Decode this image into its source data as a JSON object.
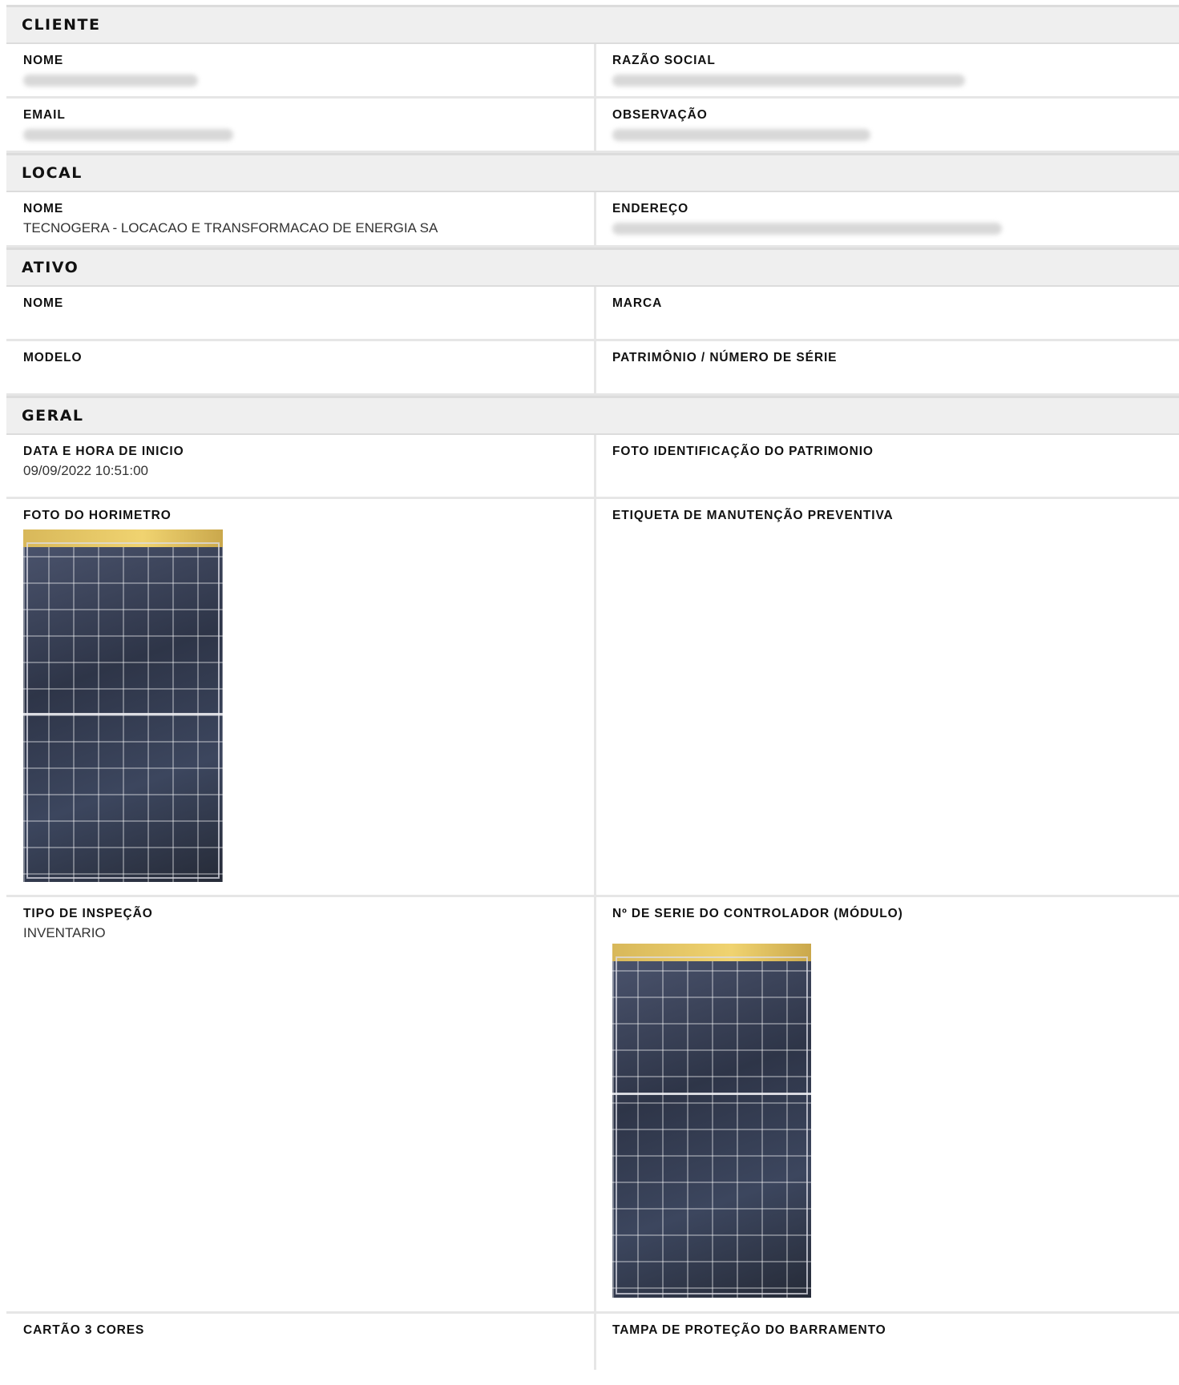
{
  "cliente": {
    "title": "CLIENTE",
    "nome_label": "NOME",
    "razao_social_label": "RAZÃO SOCIAL",
    "email_label": "EMAIL",
    "observacao_label": "OBSERVAÇÃO"
  },
  "local": {
    "title": "LOCAL",
    "nome_label": "NOME",
    "nome_value": "TECNOGERA - LOCACAO E TRANSFORMACAO DE ENERGIA SA",
    "endereco_label": "ENDEREÇO"
  },
  "ativo": {
    "title": "ATIVO",
    "nome_label": "NOME",
    "marca_label": "MARCA",
    "modelo_label": "MODELO",
    "patrimonio_label": "PATRIMÔNIO / NÚMERO DE SÉRIE"
  },
  "geral": {
    "title": "GERAL",
    "data_inicio_label": "DATA E HORA DE INICIO",
    "data_inicio_value": "09/09/2022 10:51:00",
    "foto_patrimonio_label": "FOTO IDENTIFICAÇÃO DO PATRIMONIO",
    "foto_horimetro_label": "FOTO DO HORIMETRO",
    "etiqueta_label": "ETIQUETA DE MANUTENÇÃO PREVENTIVA",
    "tipo_inspecao_label": "TIPO DE INSPEÇÃO",
    "tipo_inspecao_value": "INVENTARIO",
    "serie_controlador_label": "Nº DE SERIE DO CONTROLADOR (MÓDULO)",
    "cartao_label": "CARTÃO 3 CORES",
    "tampa_label": "TAMPA DE PROTEÇÃO DO BARRAMENTO"
  }
}
